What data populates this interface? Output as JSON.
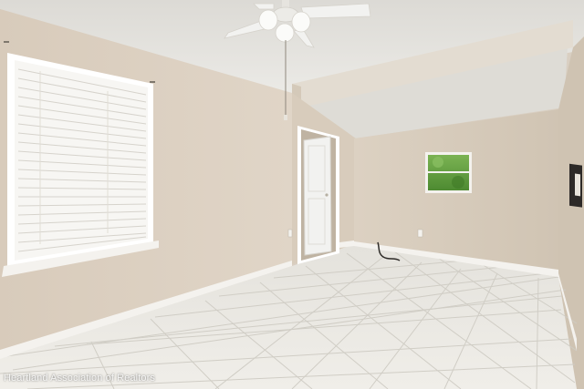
{
  "watermark": {
    "text": "Heartland Association of Realtors"
  },
  "colors": {
    "wall_left": "#dccfc0",
    "wall_back": "#d6cab9",
    "ceiling": "#e8e6e1",
    "floor_tile": "#ebe9e3",
    "grout": "#cfccc4",
    "baseboard": "#f4f2ee",
    "door": "#f2f2f0",
    "window_greenery": "#5f9a3e"
  },
  "icons": [
    "ceiling-fan-icon",
    "window-blinds-icon",
    "door-icon",
    "small-window-icon",
    "electrical-outlet-icon",
    "wall-light-fixture-icon"
  ]
}
